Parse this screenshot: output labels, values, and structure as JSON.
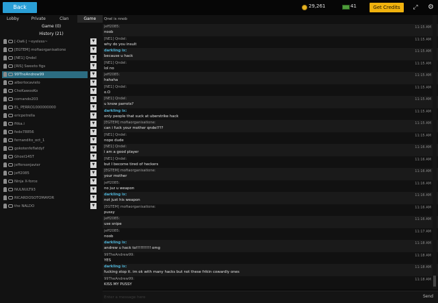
{
  "topbar": {
    "back_label": "Back",
    "coins": "29,261",
    "cash": "41",
    "credits_label": "Get Credits",
    "expand_icon": "expand-icon",
    "gear_icon": "gear-icon",
    "colors": {
      "back": "#2a9fd6",
      "credits": "#f0b20e"
    }
  },
  "tabs": [
    {
      "label": "Lobby"
    },
    {
      "label": "Private"
    },
    {
      "label": "Clan"
    },
    {
      "label": "Game"
    }
  ],
  "active_tab": "Game",
  "sections": {
    "game": "Game (0)",
    "history": "History (21)"
  },
  "players": [
    {
      "name": "[-DaK-] ~eyeless~"
    },
    {
      "name": "[EGTEM] mofiaorganisatione"
    },
    {
      "name": "[NE1] Qndel"
    },
    {
      "name": "[RIS] Sweeto figs"
    },
    {
      "name": "99TheAndrew99"
    },
    {
      "name": "albertocavielo"
    },
    {
      "name": "ChoKawooKo"
    },
    {
      "name": "comando203"
    },
    {
      "name": "EL_PERRO1000000000"
    },
    {
      "name": "ericpetrella"
    },
    {
      "name": "fitka.i"
    },
    {
      "name": "fede78856"
    },
    {
      "name": "fernandito_oct_1"
    },
    {
      "name": "gokotenfeflatdyf"
    },
    {
      "name": "Ghost14ST"
    },
    {
      "name": "jeffersonjavier"
    },
    {
      "name": "jeff2085"
    },
    {
      "name": "Ninja X-force"
    },
    {
      "name": "NULNULT93"
    },
    {
      "name": "RICARDOSOTOMAYOR"
    },
    {
      "name": "the NALDO"
    }
  ],
  "selected_player": "99TheAndrew99",
  "chat": {
    "first_line": "Qnel is nnob",
    "messages": [
      {
        "sender": "jeff2085:",
        "text": "noob",
        "time": "11:15 AM",
        "hl": false
      },
      {
        "sender": "[NE1] Qndel:",
        "text": "why do you insult",
        "time": "11:15 AM",
        "hl": false
      },
      {
        "sender": "darkling ix:",
        "text": "because u hack",
        "time": "11:15 AM",
        "hl": true
      },
      {
        "sender": "[NE1] Qndel:",
        "text": "lol no",
        "time": "11:15 AM",
        "hl": false
      },
      {
        "sender": "jeff2085:",
        "text": "hahaha",
        "time": "11:15 AM",
        "hl": false
      },
      {
        "sender": "[NE1] Qndel:",
        "text": "o.O",
        "time": "11:15 AM",
        "hl": false
      },
      {
        "sender": "[NE1] Qndel:",
        "text": "u know parrots?",
        "time": "11:15 AM",
        "hl": false
      },
      {
        "sender": "darkling ix:",
        "text": "only people that suck at uberstrike hack",
        "time": "11:15 AM",
        "hl": true
      },
      {
        "sender": "[EGTEM] mofiaorganisatione:",
        "text": "can i fuck your mother qndel???",
        "time": "11:15 AM",
        "hl": false
      },
      {
        "sender": "[NE1] Qndel:",
        "text": "nope dude",
        "time": "11:15 AM",
        "hl": false
      },
      {
        "sender": "[NE1] Qndel:",
        "text": "i am a good player",
        "time": "11:16 AM",
        "hl": false
      },
      {
        "sender": "[NE1] Qndel:",
        "text": "but I become tired of heckers",
        "time": "11:16 AM",
        "hl": false
      },
      {
        "sender": "[EGTEM] mofiaorganisatione:",
        "text": "your mother",
        "time": "11:16 AM",
        "hl": false
      },
      {
        "sender": "jeff2085:",
        "text": "no juz u weapon",
        "time": "11:16 AM",
        "hl": false
      },
      {
        "sender": "darkling ix:",
        "text": "not just his weapon",
        "time": "11:16 AM",
        "hl": true
      },
      {
        "sender": "[EGTEM] mofiaorganisatione:",
        "text": "pussy",
        "time": "11:16 AM",
        "hl": false
      },
      {
        "sender": "jeff2085:",
        "text": "use snipe",
        "time": "11:16 AM",
        "hl": false
      },
      {
        "sender": "jeff2085:",
        "text": "noob",
        "time": "11:17 AM",
        "hl": false
      },
      {
        "sender": "darkling ix:",
        "text": "andrew u hack to!!!!!!!!!! omg",
        "time": "11:18 AM",
        "hl": true
      },
      {
        "sender": "99TheAndrew99:",
        "text": "YES",
        "time": "11:18 AM",
        "hl": false
      },
      {
        "sender": "darkling ix:",
        "text": "fucking stop it. im ok with many hacks but not these frikin cowardly ones",
        "time": "11:18 AM",
        "hl": true
      },
      {
        "sender": "99TheAndrew99:",
        "text": "KISS MY PUSSY",
        "time": "11:18 AM",
        "hl": false
      }
    ]
  },
  "input": {
    "placeholder": "Enter a message here",
    "value": "",
    "send_label": "Send"
  }
}
